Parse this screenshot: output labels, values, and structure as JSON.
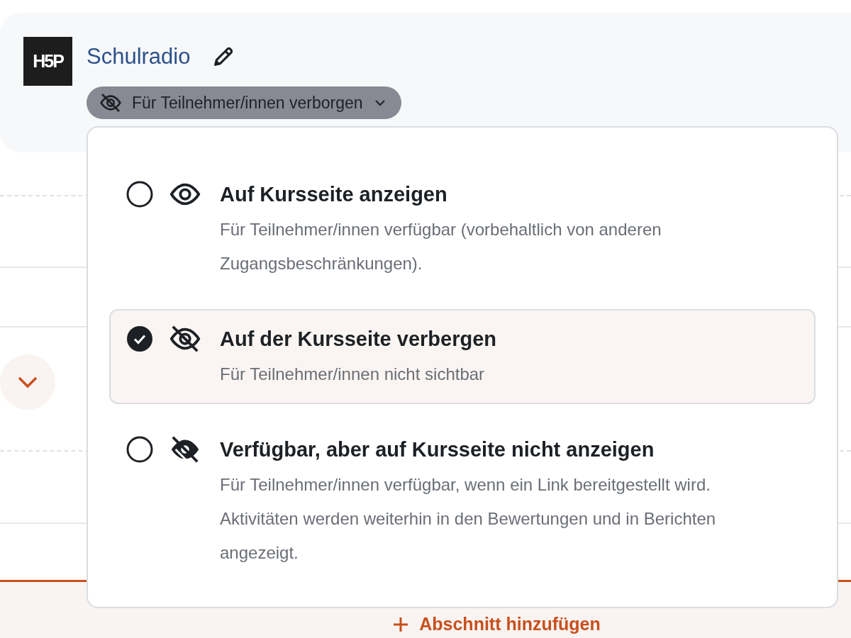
{
  "activity": {
    "logo_text": "H5P",
    "title": "Schulradio",
    "visibility_badge": "Für Teilnehmer/innen verborgen"
  },
  "visibility_menu": {
    "options": [
      {
        "kind": "show",
        "title": "Auf Kursseite anzeigen",
        "description": "Für Teilnehmer/innen verfügbar (vorbehaltlich von anderen Zugangsbeschränkungen).",
        "selected": false
      },
      {
        "kind": "hide",
        "title": "Auf der Kursseite verbergen",
        "description": "Für Teilnehmer/innen nicht sichtbar",
        "selected": true
      },
      {
        "kind": "stealth",
        "title": "Verfügbar, aber auf Kursseite nicht anzeigen",
        "description": "Für Teilnehmer/innen verfügbar, wenn ein Link bereitgestellt wird. Aktivitäten werden weiterhin in den Bewertungen und in Berichten angezeigt.",
        "selected": false
      }
    ]
  },
  "add_section": {
    "label": "Abschnitt hinzufügen"
  }
}
